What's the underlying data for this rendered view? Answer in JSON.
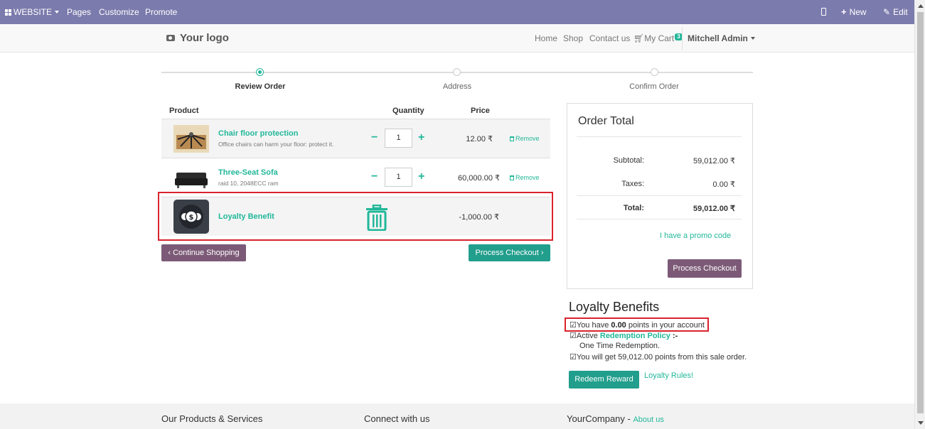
{
  "admin_bar": {
    "website_menu": "WEBSITE",
    "pages": "Pages",
    "customize": "Customize",
    "promote": "Promote",
    "new": "New",
    "edit": "Edit"
  },
  "header": {
    "logo": "Your logo",
    "nav": [
      "Home",
      "Shop",
      "Contact us"
    ],
    "cart_label": "My Cart",
    "cart_count": "3",
    "user": "Mitchell Admin"
  },
  "steps": [
    "Review Order",
    "Address",
    "Confirm Order"
  ],
  "cart": {
    "headers": {
      "product": "Product",
      "quantity": "Quantity",
      "price": "Price"
    },
    "rows": [
      {
        "name": "Chair floor protection",
        "desc": "Office chairs can harm your floor: protect it.",
        "qty": "1",
        "price": "12.00 ₹",
        "remove": "Remove"
      },
      {
        "name": "Three-Seat Sofa",
        "desc": "raid 10, 2048ECC ram",
        "qty": "1",
        "price": "60,000.00 ₹",
        "remove": "Remove"
      },
      {
        "name": "Loyalty Benefit",
        "price": "-1,000.00 ₹"
      }
    ],
    "continue_btn": "Continue Shopping",
    "checkout_btn": "Process Checkout"
  },
  "order_total": {
    "title": "Order Total",
    "subtotal_label": "Subtotal:",
    "subtotal": "59,012.00 ₹",
    "taxes_label": "Taxes:",
    "taxes": "0.00 ₹",
    "total_label": "Total:",
    "total": "59,012.00 ₹",
    "promo": "I have a promo code",
    "checkout_btn": "Process Checkout"
  },
  "loyalty": {
    "title": "Loyalty Benefits",
    "points_prefix": "☑You have ",
    "points": "0.00",
    "points_suffix": " points in your account .",
    "policy_prefix": "☑Active ",
    "policy_link": "Redemption Policy",
    "policy_suffix": " :-",
    "policy_detail": "One Time Redemption.",
    "earn": "☑You will get 59,012.00 points from this sale order.",
    "redeem_btn": "Redeem Reward",
    "rules": "Loyalty Rules!"
  },
  "footer": {
    "col1": "Our Products & Services",
    "col2": "Connect with us",
    "col3": "YourCompany",
    "col3_sep": " - ",
    "col3_link": "About us"
  },
  "colors": {
    "admin_bar": "#7c7bad",
    "accent": "#21b799",
    "purple_button": "#7c5a77",
    "highlight": "#d9232e"
  }
}
